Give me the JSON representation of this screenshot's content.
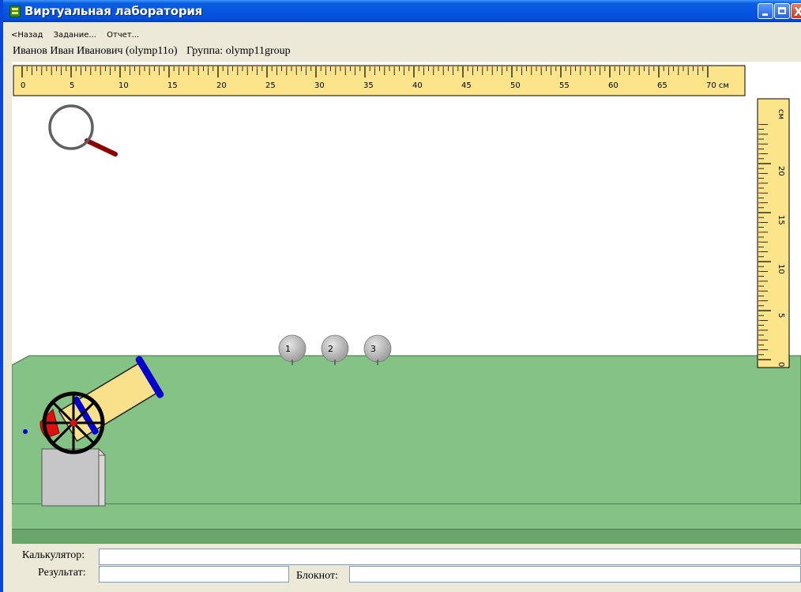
{
  "window": {
    "title": "Виртуальная лаборатория",
    "min_label": "_",
    "max_label": "□",
    "close_label": "X"
  },
  "menu": {
    "back": "<Назад",
    "task": "Задание...",
    "report": "Отчет..."
  },
  "user": {
    "name": "Иванов Иван Иванович (olymp11o)",
    "group": "Группа: olymp11group"
  },
  "horizontal_ruler": {
    "labels": [
      "0",
      "5",
      "10",
      "15",
      "20",
      "25",
      "30",
      "35",
      "40",
      "45",
      "50",
      "55",
      "60",
      "65",
      "70 см"
    ],
    "unit": "см",
    "max": 70
  },
  "vertical_ruler": {
    "labels": [
      "0",
      "5",
      "10",
      "15",
      "20"
    ],
    "unit": "см",
    "max": 24
  },
  "balls": [
    {
      "label": "1"
    },
    {
      "label": "2"
    },
    {
      "label": "3"
    }
  ],
  "colors": {
    "ruler_fill": "#fbe48a",
    "table_fill": "#84c286",
    "table_edge": "#3e6f3e",
    "barrel_fill": "#f9e18b",
    "barrel_band": "#0000cc",
    "wheel": "#000000",
    "ball": "#9c9c9c"
  },
  "icons": {
    "magnifier": "magnifier-icon",
    "cannon": "cannon-icon"
  },
  "bottom": {
    "calc_label": "Калькулятор:",
    "calc_value": "",
    "result_label": "Результат:",
    "result_value": "",
    "notebook_label": "Блокнот:",
    "notebook_value": ""
  }
}
